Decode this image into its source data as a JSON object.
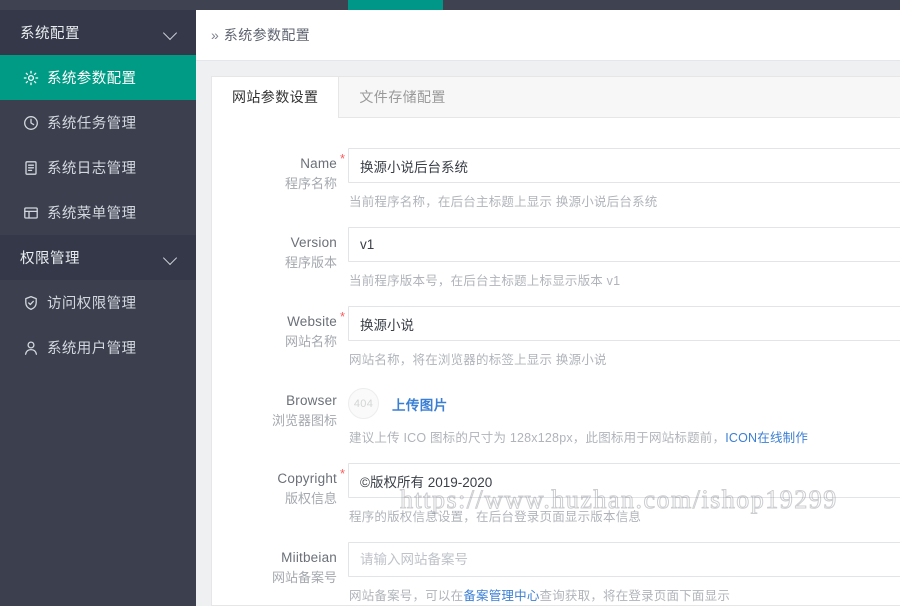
{
  "topbar": {
    "active_tab_color": "#009688",
    "bar_color": "#3e4251"
  },
  "sidebar": {
    "bg_color": "#3b3f4e",
    "active_color": "#009b84",
    "groups": [
      {
        "label": "系统配置",
        "icon": "chevron-down-icon",
        "items": [
          {
            "label": "系统参数配置",
            "icon": "gear-icon",
            "active": true
          },
          {
            "label": "系统任务管理",
            "icon": "clock-icon",
            "active": false
          },
          {
            "label": "系统日志管理",
            "icon": "log-icon",
            "active": false
          },
          {
            "label": "系统菜单管理",
            "icon": "window-icon",
            "active": false
          }
        ]
      },
      {
        "label": "权限管理",
        "icon": "chevron-down-icon",
        "items": [
          {
            "label": "访问权限管理",
            "icon": "shield-icon",
            "active": false
          },
          {
            "label": "系统用户管理",
            "icon": "user-icon",
            "active": false
          }
        ]
      }
    ]
  },
  "breadcrumb": {
    "arrow": "»",
    "title": "系统参数配置"
  },
  "tabs": [
    {
      "label": "网站参数设置",
      "active": true
    },
    {
      "label": "文件存储配置",
      "active": false
    }
  ],
  "form": {
    "fields": [
      {
        "label_en": "Name",
        "label_cn": "程序名称",
        "required": true,
        "value": "换源小说后台系统",
        "placeholder": "",
        "hint_before": "当前程序名称，在后台主标题上显示 换源小说后台系统",
        "hint_link": "",
        "hint_after": ""
      },
      {
        "label_en": "Version",
        "label_cn": "程序版本",
        "required": false,
        "value": "v1",
        "placeholder": "",
        "hint_before": "当前程序版本号，在后台主标题上标显示版本 v1",
        "hint_link": "",
        "hint_after": ""
      },
      {
        "label_en": "Website",
        "label_cn": "网站名称",
        "required": true,
        "value": "换源小说",
        "placeholder": "",
        "hint_before": "网站名称，将在浏览器的标签上显示 换源小说",
        "hint_link": "",
        "hint_after": ""
      },
      {
        "label_en": "Browser",
        "label_cn": "浏览器图标",
        "required": false,
        "type": "upload",
        "thumb_text": "404",
        "upload_label": "上传图片",
        "hint_before": "建议上传 ICO 图标的尺寸为 128x128px，此图标用于网站标题前，",
        "hint_link": "ICON在线制作",
        "hint_after": ""
      },
      {
        "label_en": "Copyright",
        "label_cn": "版权信息",
        "required": true,
        "value": "©版权所有 2019-2020",
        "placeholder": "",
        "hint_before": "程序的版权信息设置，在后台登录页面显示版本信息",
        "hint_link": "",
        "hint_after": ""
      },
      {
        "label_en": "Miitbeian",
        "label_cn": "网站备案号",
        "required": false,
        "value": "",
        "placeholder": "请输入网站备案号",
        "hint_before": "网站备案号，可以在",
        "hint_link": "备案管理中心",
        "hint_after": "查询获取，将在登录页面下面显示"
      }
    ]
  },
  "watermark": {
    "text": "https://www.huzhan.com/ishop19299"
  }
}
